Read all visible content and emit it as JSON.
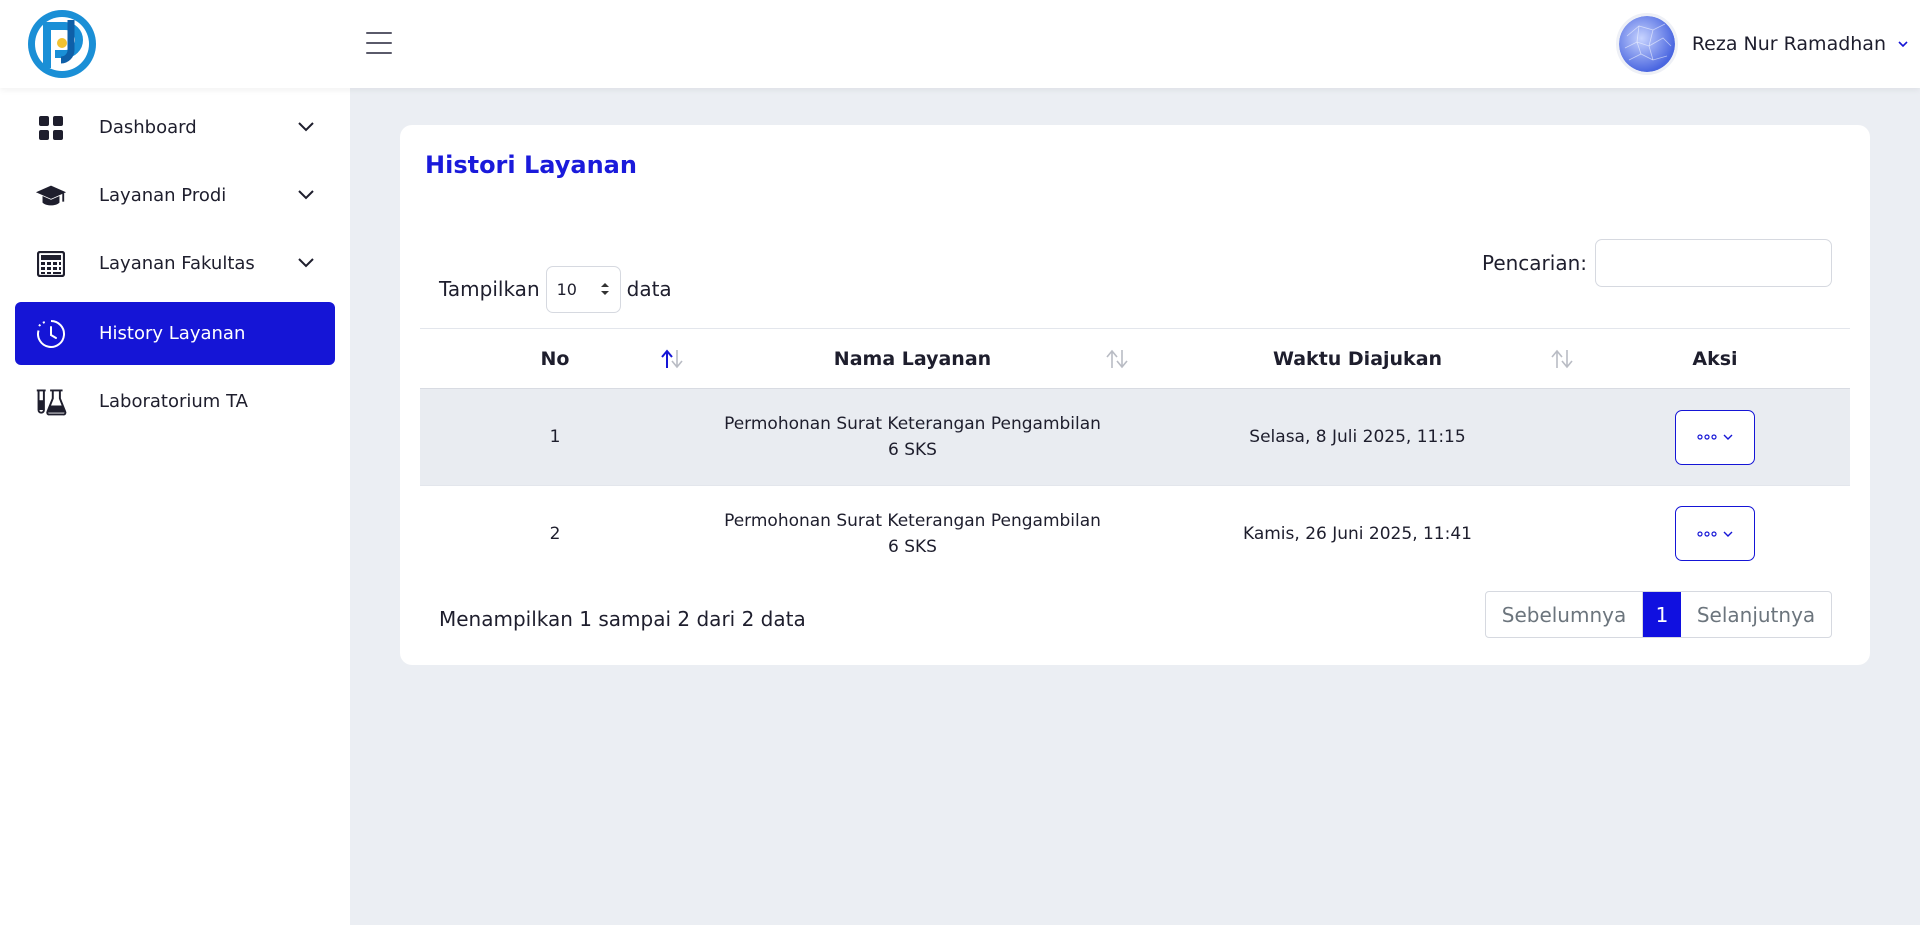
{
  "header": {
    "user_name": "Reza Nur Ramadhan"
  },
  "colors": {
    "accent": "#1515d6",
    "title": "#1a1adb",
    "page_bg": "#ebeef3"
  },
  "sidebar": {
    "items": [
      {
        "label": "Dashboard",
        "icon": "dashboard-grid-icon",
        "has_chevron": true,
        "active": false
      },
      {
        "label": "Layanan Prodi",
        "icon": "graduation-cap-icon",
        "has_chevron": true,
        "active": false
      },
      {
        "label": "Layanan Fakultas",
        "icon": "calculator-icon",
        "has_chevron": true,
        "active": false
      },
      {
        "label": "History Layanan",
        "icon": "clock-history-icon",
        "has_chevron": false,
        "active": true
      },
      {
        "label": "Laboratorium TA",
        "icon": "lab-flask-icon",
        "has_chevron": false,
        "active": false
      }
    ]
  },
  "main": {
    "title": "Histori Layanan",
    "length": {
      "prefix": "Tampilkan",
      "value": "10",
      "suffix": "data"
    },
    "search": {
      "label": "Pencarian:",
      "value": ""
    },
    "table": {
      "columns": [
        "No",
        "Nama Layanan",
        "Waktu Diajukan",
        "Aksi"
      ],
      "sort": {
        "column": "No",
        "direction": "asc"
      },
      "rows": [
        {
          "no": "1",
          "nama_line1": "Permohonan Surat Keterangan Pengambilan",
          "nama_line2": "6 SKS",
          "waktu": "Selasa, 8 Juli 2025, 11:15"
        },
        {
          "no": "2",
          "nama_line1": "Permohonan Surat Keterangan Pengambilan",
          "nama_line2": "6 SKS",
          "waktu": "Kamis, 26 Juni 2025, 11:41"
        }
      ]
    },
    "info": "Menampilkan 1 sampai 2 dari 2 data",
    "pagination": {
      "prev": "Sebelumnya",
      "current": "1",
      "next": "Selanjutnya"
    }
  }
}
